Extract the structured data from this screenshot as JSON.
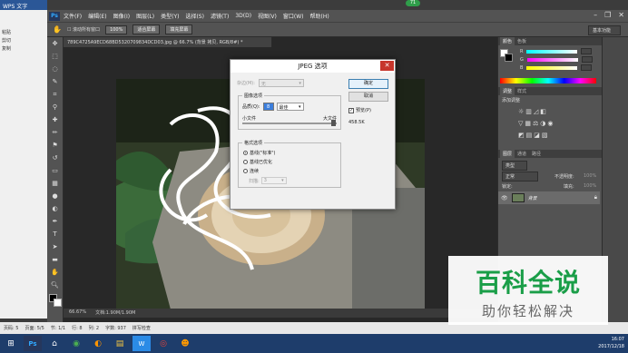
{
  "wps": {
    "title": "WPS 文字",
    "side_items": [
      "粘贴",
      "剪切",
      "复制"
    ]
  },
  "ps": {
    "logo": "Ps",
    "menu": [
      "文件(F)",
      "编辑(E)",
      "图像(I)",
      "图层(L)",
      "类型(Y)",
      "选择(S)",
      "滤镜(T)",
      "3D(D)",
      "视图(V)",
      "窗口(W)",
      "帮助(H)"
    ],
    "options": {
      "scroll_all": "滚动所有窗口",
      "btn_100": "100%",
      "btn_fit": "适合屏幕",
      "btn_fill": "填充屏幕",
      "workspace": "基本功能"
    },
    "doc_tab": "789C4725A9ECD68BD5320709834DCD03.jpg @ 66.7% (背景 拷贝, RGB/8#) *",
    "doc_status": {
      "zoom": "66.67%",
      "doc_size": "文档:1.90M/1.90M"
    }
  },
  "panels": {
    "color_tabs": [
      "颜色",
      "色板"
    ],
    "color_labels": [
      "R",
      "G",
      "B"
    ],
    "adjust_tabs": [
      "调整",
      "样式"
    ],
    "adjust_title": "添加调整",
    "layer_tabs": [
      "图层",
      "通道",
      "路径"
    ],
    "layer_kind": "类型",
    "blend_mode": "正常",
    "opacity_label": "不透明度:",
    "opacity": "100%",
    "lock_label": "锁定:",
    "fill_label": "填充:",
    "fill": "100%",
    "layer_name": "背景"
  },
  "dialog": {
    "title": "JPEG 选项",
    "matte_label": "杂边(M):",
    "matte_value": "无",
    "image_options": "图像选项",
    "quality_label": "品质(Q):",
    "quality_value": "8",
    "quality_preset": "最佳",
    "small_file": "小文件",
    "large_file": "大文件",
    "format_options": "格式选项",
    "format_baseline_std": "基线(\"标准\")",
    "format_baseline_opt": "基线已优化",
    "format_progressive": "连续",
    "scans_label": "扫描:",
    "scans_value": "3",
    "ok": "确定",
    "cancel": "取消",
    "preview": "预览(P)",
    "file_size": "458.5K"
  },
  "wps_status": [
    "页码: 5",
    "页面: 5/5",
    "节: 1/1",
    "行: 8",
    "列: 2",
    "字数: 937",
    "拼写检查"
  ],
  "watermark": {
    "title": "百科全说",
    "subtitle": "助你轻松解决"
  },
  "clock": {
    "time": "16:07",
    "date": "2017/12/18"
  },
  "badge": "71",
  "colors": {
    "ps_dark": "#535353",
    "dialog_bg": "#f0f0f0",
    "brand_green": "#1a9e48",
    "taskbar": "#1e3d6b"
  }
}
